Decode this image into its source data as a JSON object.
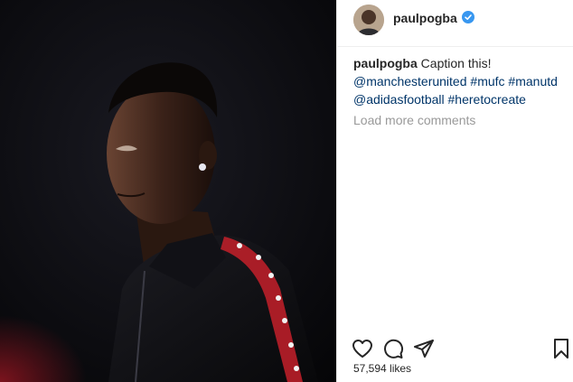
{
  "header": {
    "username": "paulpogba",
    "verified_icon": "verified-badge-icon",
    "verified_color": "#3897f0"
  },
  "caption": {
    "author": "paulpogba",
    "text": "Caption this!",
    "mentions_and_tags": [
      "@manchesterunited",
      "#mufc",
      "#manutd",
      "@adidasfootball",
      "#heretocreate"
    ]
  },
  "comments": {
    "load_more_label": "Load more comments"
  },
  "actions": {
    "like_icon": "heart-icon",
    "comment_icon": "comment-icon",
    "share_icon": "share-icon",
    "save_icon": "bookmark-icon"
  },
  "likes": {
    "text": "57,594 likes"
  },
  "colors": {
    "link": "#003569",
    "muted": "#999999",
    "text": "#262626",
    "jacket_stripe": "#c4202a"
  }
}
